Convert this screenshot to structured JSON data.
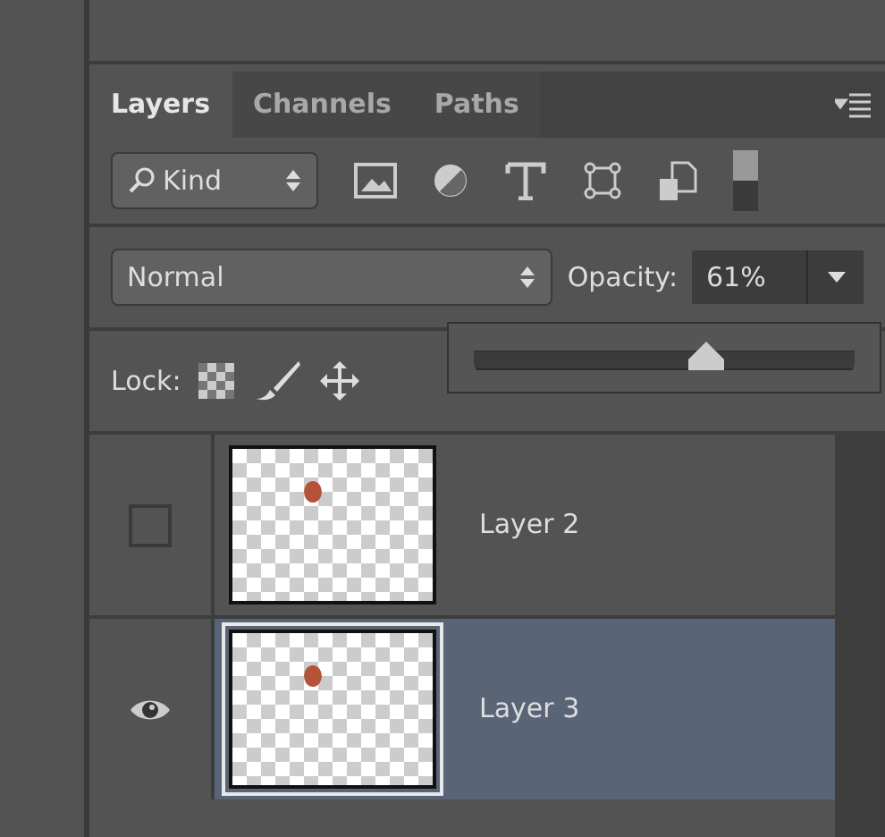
{
  "tabs": [
    {
      "label": "Layers",
      "selected": true
    },
    {
      "label": "Channels",
      "selected": false
    },
    {
      "label": "Paths",
      "selected": false
    }
  ],
  "filter": {
    "value": "Kind"
  },
  "blend_mode": {
    "value": "Normal"
  },
  "opacity": {
    "label": "Opacity:",
    "value": "61%",
    "slider": {
      "level": 0.61
    }
  },
  "lock": {
    "label": "Lock:"
  },
  "layers": [
    {
      "name": "Layer 2",
      "visible": false,
      "selected": false
    },
    {
      "name": "Layer 3",
      "visible": true,
      "selected": true
    }
  ]
}
